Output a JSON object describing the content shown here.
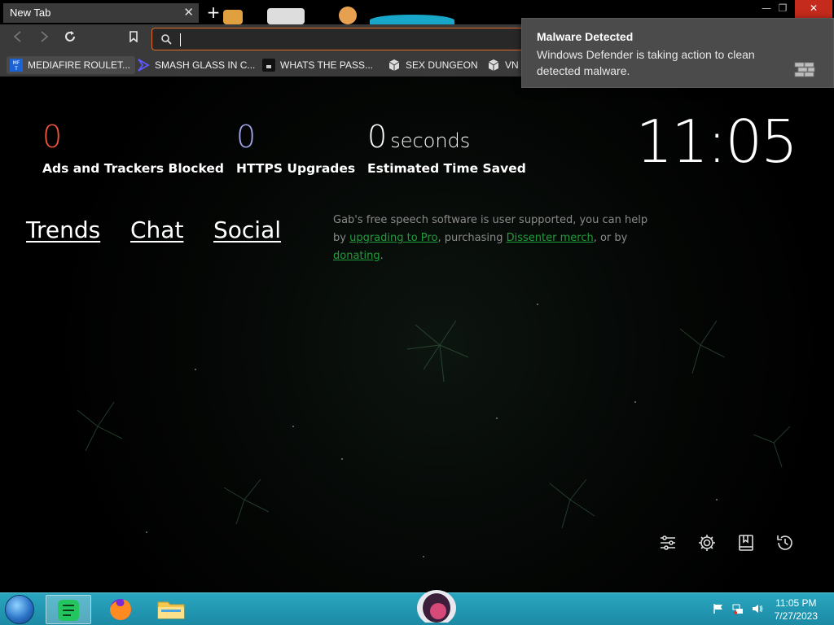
{
  "browser": {
    "tab_title": "New Tab",
    "tab_close": "✕",
    "new_tab": "+",
    "address_value": "",
    "bookmarks": [
      {
        "label": "MEDIAFIRE ROULET...",
        "icon": "mediafire-icon"
      },
      {
        "label": "SMASH GLASS IN C...",
        "icon": "chevron-logo-icon"
      },
      {
        "label": "WHATS THE PASS...",
        "icon": "lock-site-icon"
      },
      {
        "label": "SEX DUNGEON",
        "icon": "cube-icon"
      },
      {
        "label": "VN",
        "icon": "cube-icon"
      }
    ]
  },
  "stats": {
    "ads_blocked": {
      "value": "0",
      "label": "Ads and Trackers Blocked",
      "color": "#f0563a"
    },
    "https_upgrades": {
      "value": "0",
      "label": "HTTPS Upgrades",
      "color": "#a0a5eb"
    },
    "time_saved": {
      "value": "0",
      "unit": "seconds",
      "label": "Estimated Time Saved"
    }
  },
  "clock": "11:05",
  "links": [
    {
      "label": "Trends"
    },
    {
      "label": "Chat"
    },
    {
      "label": "Social"
    }
  ],
  "promo": {
    "text_1": "Gab's free speech software is user supported, you can help by ",
    "link_1": "upgrading to Pro",
    "text_2": ", purchasing ",
    "link_2": "Dissenter merch",
    "text_3": ", or by ",
    "link_3": "donating",
    "text_4": ".",
    "link_color": "#1f9e3a"
  },
  "notification": {
    "title": "Malware Detected",
    "body": "Windows Defender is taking action to clean detected malware."
  },
  "taskbar": {
    "time": "11:05 PM",
    "date": "7/27/2023"
  },
  "colors": {
    "accent": "#e06c2b",
    "taskbar": "#1f96b0"
  }
}
